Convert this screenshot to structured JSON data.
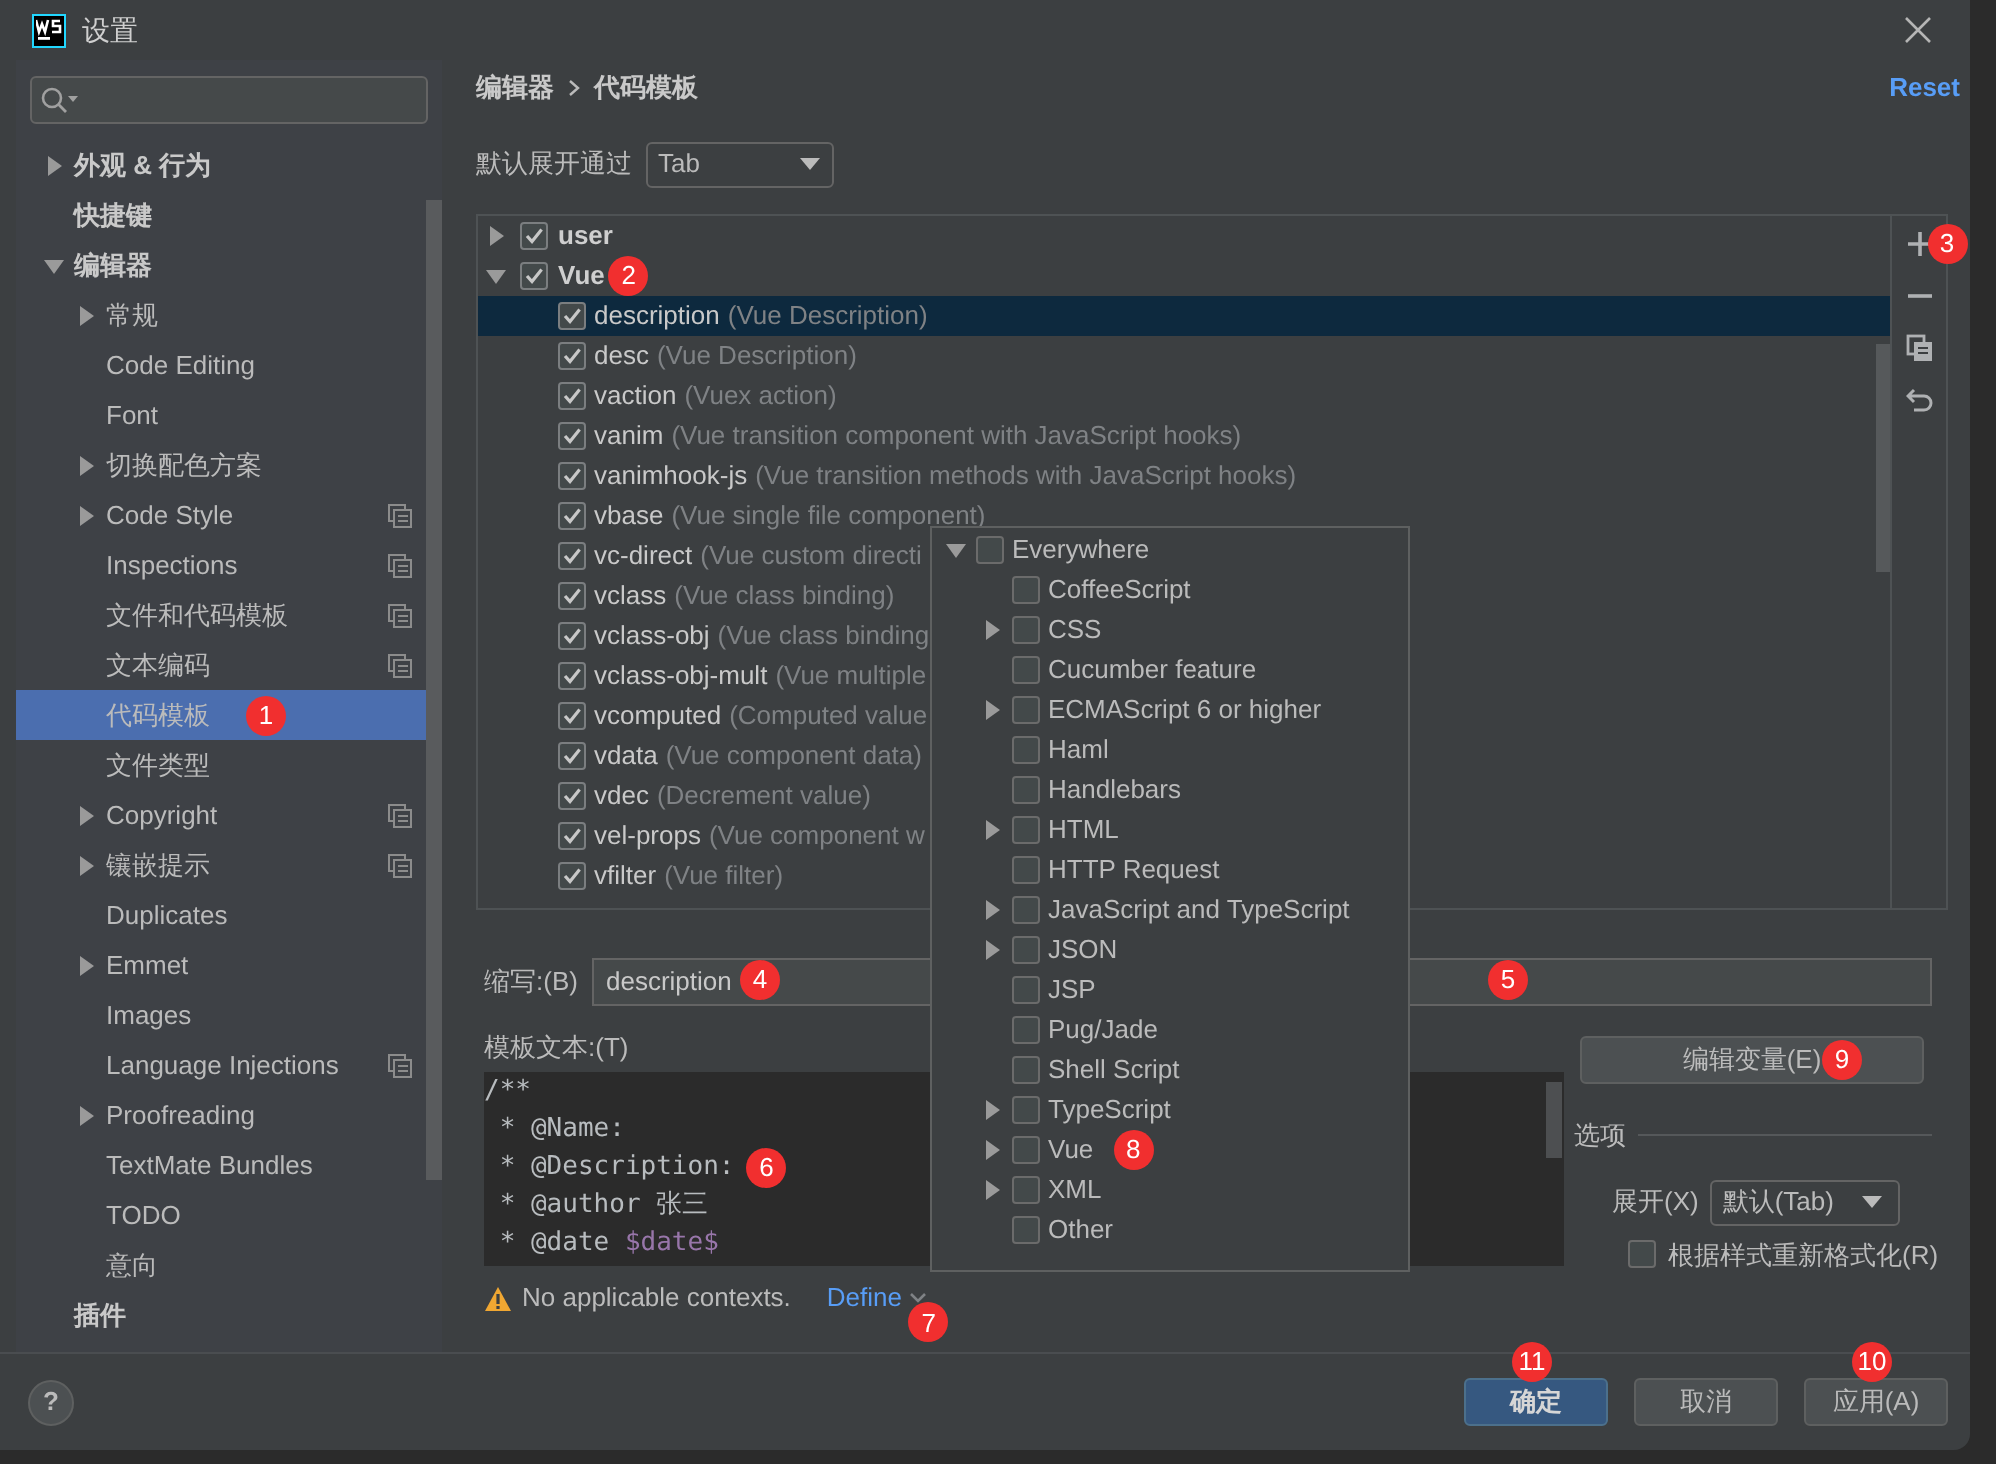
{
  "window": {
    "title": "设置"
  },
  "sidebar": {
    "items": [
      {
        "label": "外观 & 行为",
        "expanded": false,
        "selected": false,
        "project_scope": false
      },
      {
        "label": "快捷键",
        "selected": false,
        "project_scope": false
      },
      {
        "label": "编辑器",
        "expanded": true,
        "selected": false,
        "project_scope": false,
        "children": [
          {
            "label": "常规",
            "expanded": false,
            "selected": false,
            "project_scope": false
          },
          {
            "label": "Code Editing",
            "selected": false,
            "project_scope": false
          },
          {
            "label": "Font",
            "selected": false,
            "project_scope": false
          },
          {
            "label": "切换配色方案",
            "expanded": false,
            "selected": false,
            "project_scope": false
          },
          {
            "label": "Code Style",
            "expanded": false,
            "selected": false,
            "project_scope": true
          },
          {
            "label": "Inspections",
            "selected": false,
            "project_scope": true
          },
          {
            "label": "文件和代码模板",
            "selected": false,
            "project_scope": true
          },
          {
            "label": "文本编码",
            "selected": false,
            "project_scope": true
          },
          {
            "label": "代码模板",
            "selected": true,
            "project_scope": false,
            "marker": "1"
          },
          {
            "label": "文件类型",
            "selected": false,
            "project_scope": false
          },
          {
            "label": "Copyright",
            "expanded": false,
            "selected": false,
            "project_scope": true
          },
          {
            "label": "镶嵌提示",
            "expanded": false,
            "selected": false,
            "project_scope": true
          },
          {
            "label": "Duplicates",
            "selected": false,
            "project_scope": false
          },
          {
            "label": "Emmet",
            "expanded": false,
            "selected": false,
            "project_scope": false
          },
          {
            "label": "Images",
            "selected": false,
            "project_scope": false
          },
          {
            "label": "Language Injections",
            "selected": false,
            "project_scope": true
          },
          {
            "label": "Proofreading",
            "expanded": false,
            "selected": false,
            "project_scope": false
          },
          {
            "label": "TextMate Bundles",
            "selected": false,
            "project_scope": false
          },
          {
            "label": "TODO",
            "selected": false,
            "project_scope": false
          },
          {
            "label": "意向",
            "selected": false,
            "project_scope": false
          }
        ]
      },
      {
        "label": "插件",
        "selected": false,
        "project_scope": false
      }
    ]
  },
  "breadcrumb": [
    "编辑器",
    "代码模板"
  ],
  "reset_link": "Reset",
  "expand_with": {
    "label": "默认展开通过",
    "value": "Tab"
  },
  "template_groups": [
    {
      "name": "user",
      "checked": true,
      "expanded": false,
      "selected": false
    },
    {
      "name": "Vue",
      "checked": true,
      "expanded": true,
      "selected": false,
      "marker": "2",
      "templates": [
        {
          "abbreviation": "description",
          "description": "(Vue Description)",
          "checked": true,
          "selected": true
        },
        {
          "abbreviation": "desc",
          "description": "(Vue Description)",
          "checked": true,
          "selected": false
        },
        {
          "abbreviation": "vaction",
          "description": "(Vuex action)",
          "checked": true,
          "selected": false
        },
        {
          "abbreviation": "vanim",
          "description": "(Vue transition component with JavaScript hooks)",
          "checked": true,
          "selected": false
        },
        {
          "abbreviation": "vanimhook-js",
          "description": "(Vue transition methods with JavaScript hooks)",
          "checked": true,
          "selected": false
        },
        {
          "abbreviation": "vbase",
          "description": "(Vue single file component)",
          "checked": true,
          "selected": false
        },
        {
          "abbreviation": "vc-direct",
          "description": "(Vue custom directi",
          "checked": true,
          "selected": false
        },
        {
          "abbreviation": "vclass",
          "description": "(Vue class binding)",
          "checked": true,
          "selected": false
        },
        {
          "abbreviation": "vclass-obj",
          "description": "(Vue class binding",
          "checked": true,
          "selected": false
        },
        {
          "abbreviation": "vclass-obj-mult",
          "description": "(Vue multiple",
          "checked": true,
          "selected": false
        },
        {
          "abbreviation": "vcomputed",
          "description": "(Computed value",
          "checked": true,
          "selected": false
        },
        {
          "abbreviation": "vdata",
          "description": "(Vue component data)",
          "checked": true,
          "selected": false
        },
        {
          "abbreviation": "vdec",
          "description": "(Decrement value)",
          "checked": true,
          "selected": false
        },
        {
          "abbreviation": "vel-props",
          "description": "(Vue component w",
          "checked": true,
          "selected": false
        },
        {
          "abbreviation": "vfilter",
          "description": "(Vue filter)",
          "checked": true,
          "selected": false
        }
      ]
    }
  ],
  "toolbar": [
    {
      "kind": "add",
      "marker": "3"
    },
    {
      "kind": "remove"
    },
    {
      "kind": "copy"
    },
    {
      "kind": "revert"
    }
  ],
  "abbreviation": {
    "label": "缩写:(B)",
    "value": "description",
    "marker": "4"
  },
  "description_field": {
    "marker": "5"
  },
  "template_text": {
    "label": "模板文本:(T)",
    "lines": [
      {
        "segments": [
          {
            "kind": "plain",
            "text": "/**"
          }
        ]
      },
      {
        "segments": [
          {
            "kind": "plain",
            "text": " * @Name:"
          }
        ]
      },
      {
        "segments": [
          {
            "kind": "plain",
            "text": " * @Description:"
          }
        ],
        "marker": "6"
      },
      {
        "segments": [
          {
            "kind": "plain",
            "text": " * @author 张三"
          }
        ]
      },
      {
        "segments": [
          {
            "kind": "plain",
            "text": " * @date "
          },
          {
            "kind": "variable",
            "text": "$date$"
          }
        ]
      }
    ]
  },
  "warning": {
    "text": "No applicable contexts.",
    "link": "Define",
    "marker": "7"
  },
  "edit_variables_button": {
    "label": "编辑变量(E)",
    "marker": "9"
  },
  "options": {
    "title": "选项",
    "expand": {
      "label": "展开(X)",
      "value": "默认(Tab)"
    },
    "reformat": {
      "label": "根据样式重新格式化(R)",
      "checked": false
    }
  },
  "context_popup": {
    "items": [
      {
        "label": "Everywhere",
        "checked": false,
        "expanded": true,
        "children": [
          {
            "label": "CoffeeScript",
            "checked": false
          },
          {
            "label": "CSS",
            "checked": false,
            "expanded": false
          },
          {
            "label": "Cucumber feature",
            "checked": false
          },
          {
            "label": "ECMAScript 6 or higher",
            "checked": false,
            "expanded": false
          },
          {
            "label": "Haml",
            "checked": false
          },
          {
            "label": "Handlebars",
            "checked": false
          },
          {
            "label": "HTML",
            "checked": false,
            "expanded": false
          },
          {
            "label": "HTTP Request",
            "checked": false
          },
          {
            "label": "JavaScript and TypeScript",
            "checked": false,
            "expanded": false
          },
          {
            "label": "JSON",
            "checked": false,
            "expanded": false
          },
          {
            "label": "JSP",
            "checked": false
          },
          {
            "label": "Pug/Jade",
            "checked": false
          },
          {
            "label": "Shell Script",
            "checked": false
          },
          {
            "label": "TypeScript",
            "checked": false,
            "expanded": false
          },
          {
            "label": "Vue",
            "checked": false,
            "expanded": false,
            "marker": "8"
          },
          {
            "label": "XML",
            "checked": false,
            "expanded": false
          },
          {
            "label": "Other",
            "checked": false
          }
        ]
      }
    ]
  },
  "help_button": "?",
  "footer": {
    "buttons": [
      {
        "label": "确定",
        "kind": "primary",
        "marker": "11"
      },
      {
        "label": "取消",
        "kind": "normal"
      },
      {
        "label": "应用(A)",
        "kind": "normal",
        "marker": "10"
      }
    ]
  }
}
